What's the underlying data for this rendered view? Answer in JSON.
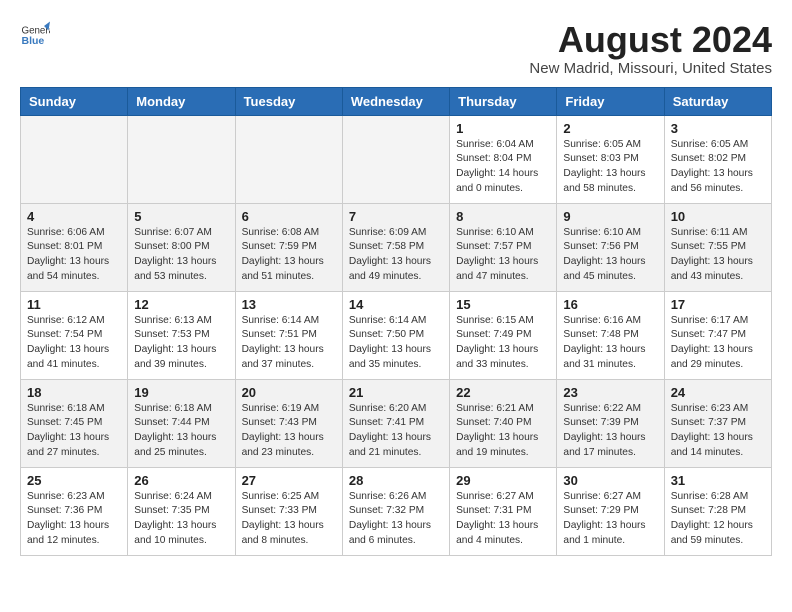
{
  "header": {
    "logo_general": "General",
    "logo_blue": "Blue",
    "month_year": "August 2024",
    "location": "New Madrid, Missouri, United States"
  },
  "weekdays": [
    "Sunday",
    "Monday",
    "Tuesday",
    "Wednesday",
    "Thursday",
    "Friday",
    "Saturday"
  ],
  "weeks": [
    [
      {
        "day": "",
        "info": ""
      },
      {
        "day": "",
        "info": ""
      },
      {
        "day": "",
        "info": ""
      },
      {
        "day": "",
        "info": ""
      },
      {
        "day": "1",
        "info": "Sunrise: 6:04 AM\nSunset: 8:04 PM\nDaylight: 14 hours\nand 0 minutes."
      },
      {
        "day": "2",
        "info": "Sunrise: 6:05 AM\nSunset: 8:03 PM\nDaylight: 13 hours\nand 58 minutes."
      },
      {
        "day": "3",
        "info": "Sunrise: 6:05 AM\nSunset: 8:02 PM\nDaylight: 13 hours\nand 56 minutes."
      }
    ],
    [
      {
        "day": "4",
        "info": "Sunrise: 6:06 AM\nSunset: 8:01 PM\nDaylight: 13 hours\nand 54 minutes."
      },
      {
        "day": "5",
        "info": "Sunrise: 6:07 AM\nSunset: 8:00 PM\nDaylight: 13 hours\nand 53 minutes."
      },
      {
        "day": "6",
        "info": "Sunrise: 6:08 AM\nSunset: 7:59 PM\nDaylight: 13 hours\nand 51 minutes."
      },
      {
        "day": "7",
        "info": "Sunrise: 6:09 AM\nSunset: 7:58 PM\nDaylight: 13 hours\nand 49 minutes."
      },
      {
        "day": "8",
        "info": "Sunrise: 6:10 AM\nSunset: 7:57 PM\nDaylight: 13 hours\nand 47 minutes."
      },
      {
        "day": "9",
        "info": "Sunrise: 6:10 AM\nSunset: 7:56 PM\nDaylight: 13 hours\nand 45 minutes."
      },
      {
        "day": "10",
        "info": "Sunrise: 6:11 AM\nSunset: 7:55 PM\nDaylight: 13 hours\nand 43 minutes."
      }
    ],
    [
      {
        "day": "11",
        "info": "Sunrise: 6:12 AM\nSunset: 7:54 PM\nDaylight: 13 hours\nand 41 minutes."
      },
      {
        "day": "12",
        "info": "Sunrise: 6:13 AM\nSunset: 7:53 PM\nDaylight: 13 hours\nand 39 minutes."
      },
      {
        "day": "13",
        "info": "Sunrise: 6:14 AM\nSunset: 7:51 PM\nDaylight: 13 hours\nand 37 minutes."
      },
      {
        "day": "14",
        "info": "Sunrise: 6:14 AM\nSunset: 7:50 PM\nDaylight: 13 hours\nand 35 minutes."
      },
      {
        "day": "15",
        "info": "Sunrise: 6:15 AM\nSunset: 7:49 PM\nDaylight: 13 hours\nand 33 minutes."
      },
      {
        "day": "16",
        "info": "Sunrise: 6:16 AM\nSunset: 7:48 PM\nDaylight: 13 hours\nand 31 minutes."
      },
      {
        "day": "17",
        "info": "Sunrise: 6:17 AM\nSunset: 7:47 PM\nDaylight: 13 hours\nand 29 minutes."
      }
    ],
    [
      {
        "day": "18",
        "info": "Sunrise: 6:18 AM\nSunset: 7:45 PM\nDaylight: 13 hours\nand 27 minutes."
      },
      {
        "day": "19",
        "info": "Sunrise: 6:18 AM\nSunset: 7:44 PM\nDaylight: 13 hours\nand 25 minutes."
      },
      {
        "day": "20",
        "info": "Sunrise: 6:19 AM\nSunset: 7:43 PM\nDaylight: 13 hours\nand 23 minutes."
      },
      {
        "day": "21",
        "info": "Sunrise: 6:20 AM\nSunset: 7:41 PM\nDaylight: 13 hours\nand 21 minutes."
      },
      {
        "day": "22",
        "info": "Sunrise: 6:21 AM\nSunset: 7:40 PM\nDaylight: 13 hours\nand 19 minutes."
      },
      {
        "day": "23",
        "info": "Sunrise: 6:22 AM\nSunset: 7:39 PM\nDaylight: 13 hours\nand 17 minutes."
      },
      {
        "day": "24",
        "info": "Sunrise: 6:23 AM\nSunset: 7:37 PM\nDaylight: 13 hours\nand 14 minutes."
      }
    ],
    [
      {
        "day": "25",
        "info": "Sunrise: 6:23 AM\nSunset: 7:36 PM\nDaylight: 13 hours\nand 12 minutes."
      },
      {
        "day": "26",
        "info": "Sunrise: 6:24 AM\nSunset: 7:35 PM\nDaylight: 13 hours\nand 10 minutes."
      },
      {
        "day": "27",
        "info": "Sunrise: 6:25 AM\nSunset: 7:33 PM\nDaylight: 13 hours\nand 8 minutes."
      },
      {
        "day": "28",
        "info": "Sunrise: 6:26 AM\nSunset: 7:32 PM\nDaylight: 13 hours\nand 6 minutes."
      },
      {
        "day": "29",
        "info": "Sunrise: 6:27 AM\nSunset: 7:31 PM\nDaylight: 13 hours\nand 4 minutes."
      },
      {
        "day": "30",
        "info": "Sunrise: 6:27 AM\nSunset: 7:29 PM\nDaylight: 13 hours\nand 1 minute."
      },
      {
        "day": "31",
        "info": "Sunrise: 6:28 AM\nSunset: 7:28 PM\nDaylight: 12 hours\nand 59 minutes."
      }
    ]
  ]
}
